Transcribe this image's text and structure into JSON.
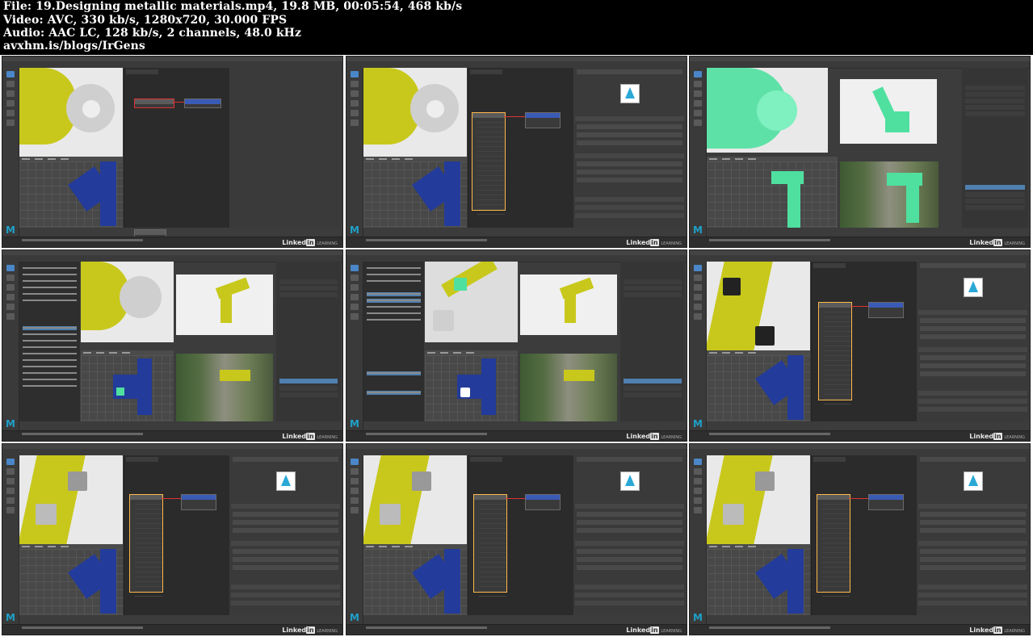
{
  "header": {
    "lines": [
      "File: 19.Designing metallic materials.mp4, 19.8 MB, 00:05:54, 468 kb/s",
      "Video: AVC, 330 kb/s, 1280x720, 30.000 FPS",
      "Audio: AAC LC, 128 kb/s, 2 channels, 48.0 kHz",
      "avxhm.is/blogs/IrGens"
    ]
  },
  "watermark": {
    "brand": "Linked",
    "brand_in": "in",
    "suffix": "LEARNING"
  },
  "app": {
    "logo": "M"
  },
  "colors": {
    "header_bg": "#000000",
    "maya_bg": "#3c3c3c",
    "robot_yellow": "#c8c81c",
    "robot_blue": "#233b9a",
    "selection_green": "#4fe0a0",
    "node_blue": "#3a5bb5",
    "selected_orange": "#ffb84a",
    "accent_cyan": "#2aa8d6"
  }
}
